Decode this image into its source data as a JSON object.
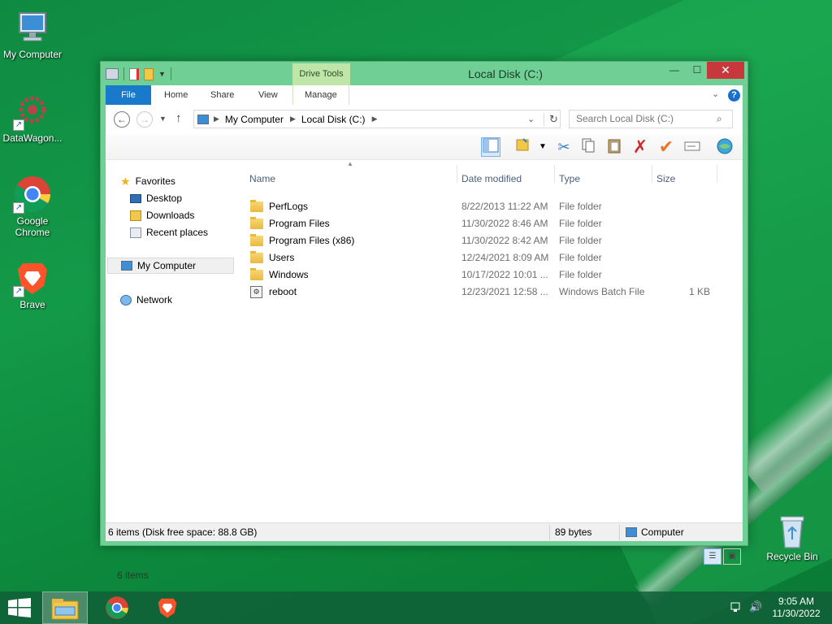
{
  "desktop": {
    "icons": [
      {
        "label": "My Computer",
        "icon": "computer-icon"
      },
      {
        "label": "DataWagon...",
        "icon": "datawagon-icon"
      },
      {
        "label": "Google Chrome",
        "icon": "chrome-icon"
      },
      {
        "label": "Brave",
        "icon": "brave-icon"
      },
      {
        "label": "Recycle Bin",
        "icon": "recycle-bin-icon"
      }
    ]
  },
  "window": {
    "title": "Local Disk (C:)",
    "contextual_tab_group": "Drive Tools",
    "tabs": [
      {
        "label": "File"
      },
      {
        "label": "Home"
      },
      {
        "label": "Share"
      },
      {
        "label": "View"
      },
      {
        "label": "Manage"
      }
    ],
    "address": {
      "breadcrumb": [
        "My Computer",
        "Local Disk (C:)"
      ]
    },
    "search": {
      "placeholder": "Search Local Disk (C:)"
    },
    "nav_pane": {
      "favorites": "Favorites",
      "favorite_items": [
        "Desktop",
        "Downloads",
        "Recent places"
      ],
      "computer": "My Computer",
      "network": "Network"
    },
    "columns": {
      "name": "Name",
      "date": "Date modified",
      "type": "Type",
      "size": "Size"
    },
    "files": [
      {
        "name": "PerfLogs",
        "date": "8/22/2013 11:22 AM",
        "type": "File folder",
        "size": "",
        "kind": "folder"
      },
      {
        "name": "Program Files",
        "date": "11/30/2022 8:46 AM",
        "type": "File folder",
        "size": "",
        "kind": "folder"
      },
      {
        "name": "Program Files (x86)",
        "date": "11/30/2022 8:42 AM",
        "type": "File folder",
        "size": "",
        "kind": "folder"
      },
      {
        "name": "Users",
        "date": "12/24/2021 8:09 AM",
        "type": "File folder",
        "size": "",
        "kind": "folder"
      },
      {
        "name": "Windows",
        "date": "10/17/2022 10:01 ...",
        "type": "File folder",
        "size": "",
        "kind": "folder"
      },
      {
        "name": "reboot",
        "date": "12/23/2021 12:58 ...",
        "type": "Windows Batch File",
        "size": "1 KB",
        "kind": "batch"
      }
    ],
    "item_count": "6 items",
    "status": {
      "left": "6 items (Disk free space: 88.8 GB)",
      "middle": "89 bytes",
      "right": "Computer"
    }
  },
  "taskbar": {
    "time": "9:05 AM",
    "date": "11/30/2022"
  },
  "colors": {
    "desktop_green": "#0f8a42",
    "window_frame": "#6fcf95",
    "close_button": "#c7383c",
    "file_tab": "#1979ca",
    "drive_tools": "#bfe6a8"
  }
}
